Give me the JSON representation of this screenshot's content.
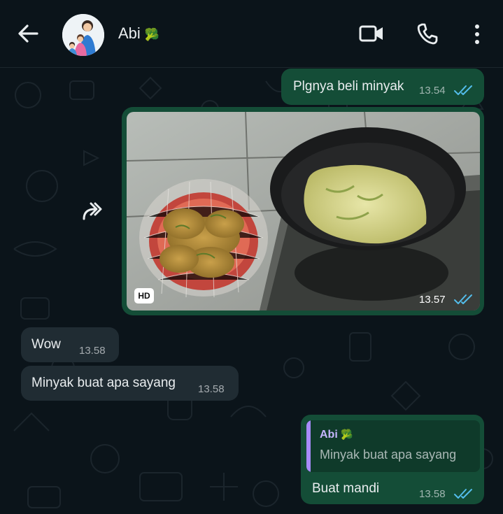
{
  "header": {
    "contact_name": "Abi",
    "contact_emoji": "🥦",
    "icons": [
      "back-arrow-icon",
      "video-call-icon",
      "voice-call-icon",
      "more-options-icon"
    ]
  },
  "messages": {
    "m1": {
      "text": "Plgnya beli minyak",
      "time": "13.54"
    },
    "m2": {
      "badge": "HD",
      "time": "13.57"
    },
    "m3": {
      "text": "Wow",
      "time": "13.58"
    },
    "m4": {
      "text": "Minyak buat apa sayang",
      "time": "13.58"
    },
    "m5": {
      "quote_author": "Abi",
      "quote_emoji": "🥦",
      "quote_text": "Minyak buat apa sayang",
      "text": "Buat mandi",
      "time": "13.58"
    }
  },
  "colors": {
    "background": "#0b141a",
    "outgoing_bubble": "#144d37",
    "incoming_bubble": "#202c33",
    "read_ticks": "#53bdeb",
    "quote_accent": "#a78bfa"
  }
}
